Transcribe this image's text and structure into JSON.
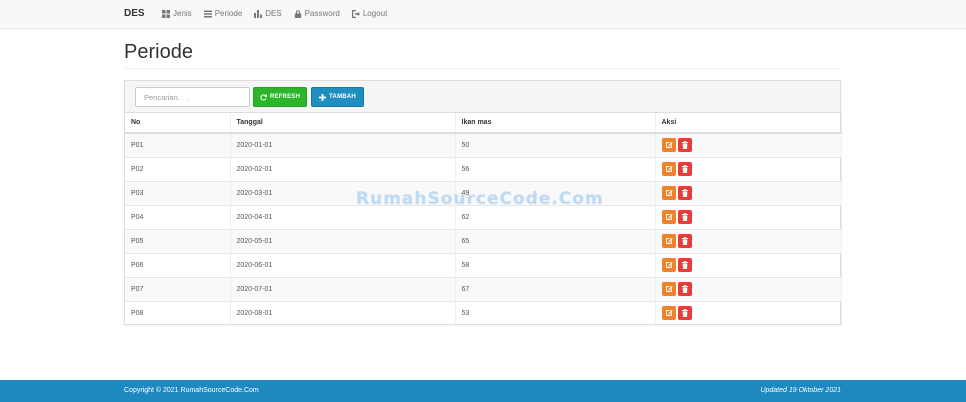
{
  "nav": {
    "brand": "DES",
    "links": [
      {
        "label": "Jenis",
        "icon": "grid-icon"
      },
      {
        "label": "Periode",
        "icon": "list-icon"
      },
      {
        "label": "DES",
        "icon": "bar-chart-icon"
      },
      {
        "label": "Password",
        "icon": "lock-icon"
      },
      {
        "label": "Logout",
        "icon": "logout-icon"
      }
    ]
  },
  "page": {
    "title": "Periode"
  },
  "toolbar": {
    "search_placeholder": "Pencarian. . .",
    "refresh_label": "REFRESH",
    "add_label": "TAMBAH",
    "refresh_color": "#2cb52a",
    "add_color": "#1e8fbf"
  },
  "table": {
    "headers": [
      "No",
      "Tanggal",
      "Ikan mas",
      "Aksi"
    ],
    "rows": [
      [
        "P01",
        "2020-01-01",
        "50"
      ],
      [
        "P02",
        "2020-02-01",
        "56"
      ],
      [
        "P03",
        "2020-03-01",
        "49"
      ],
      [
        "P04",
        "2020-04-01",
        "62"
      ],
      [
        "P05",
        "2020-05-01",
        "65"
      ],
      [
        "P06",
        "2020-06-01",
        "58"
      ],
      [
        "P07",
        "2020-07-01",
        "67"
      ],
      [
        "P08",
        "2020-08-01",
        "53"
      ]
    ],
    "edit_icon": "edit-icon",
    "delete_icon": "trash-icon",
    "edit_color": "#f0832a",
    "delete_color": "#e93b3b"
  },
  "watermark": "RumahSourceCode.Com",
  "footer": {
    "copyright": "Copyright © 2021 RumahSourceCode.Com",
    "updated": "Updated 19 Oktober 2021",
    "color": "#1d89bf"
  }
}
